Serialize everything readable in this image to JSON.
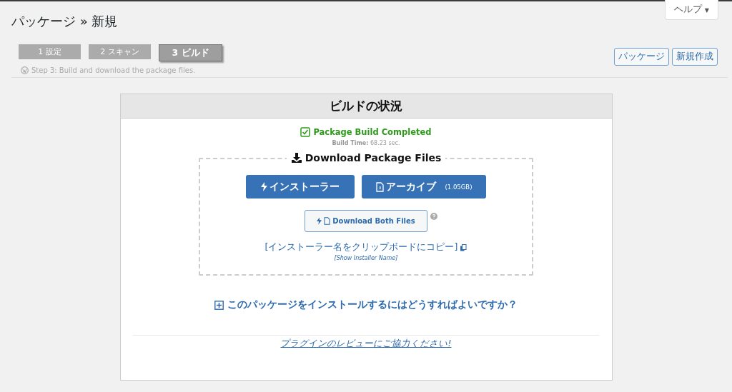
{
  "help_button": {
    "label": "ヘルプ",
    "caret": "▼"
  },
  "page_title": "パッケージ » 新規",
  "steps": [
    {
      "label": "1 設定",
      "selected": false
    },
    {
      "label": "2 スキャン",
      "selected": false
    },
    {
      "label": "3 ビルド",
      "selected": true
    }
  ],
  "step_caption": "Step 3: Build and download the package files.",
  "actions": [
    "パッケージ",
    "新規作成"
  ],
  "panel": {
    "title": "ビルドの状況",
    "status": "Package Build Completed",
    "build_time_label": "Build Time:",
    "build_time": "68.23 sec.",
    "download_title": "Download Package Files",
    "installer_button": "インストーラー",
    "archive_button": "アーカイブ",
    "archive_size": "(1.05GB)",
    "both_button": "Download Both Files",
    "copy_link": "[インストーラー名をクリップボードにコピー]",
    "show_link": "[Show Installer Name]",
    "howto": "このパッケージをインストールするにはどうすればよいですか？",
    "review_link": "プラグインのレビューにご協力ください!"
  }
}
